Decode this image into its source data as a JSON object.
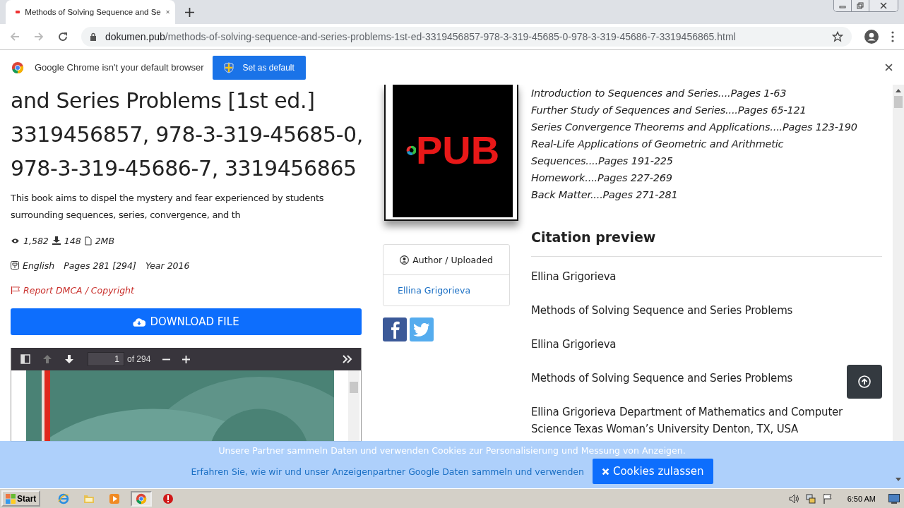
{
  "browser": {
    "tab_title": "Methods of Solving Sequence and Se",
    "url_domain": "dokumen.pub",
    "url_path": "/methods-of-solving-sequence-and-series-problems-1st-ed-3319456857-978-3-319-45685-0-978-3-319-45686-7-3319456865.html"
  },
  "infobar": {
    "message": "Google Chrome isn't your default browser",
    "button": "Set as default"
  },
  "book": {
    "title": "and Series Problems [1st ed.] 3319456857, 978-3-319-45685-0, 978-3-319-45686-7, 3319456865",
    "description": "This book aims to dispel the mystery and fear experienced by students surrounding sequences, series, convergence, and th",
    "views": "1,582",
    "downloads": "148",
    "size": "2MB",
    "language": "English",
    "pages": "Pages 281 [294]",
    "year": "Year 2016",
    "report": "Report DMCA / Copyright",
    "download": "DOWNLOAD FILE"
  },
  "pdf_viewer": {
    "page": "1",
    "total": "of 294",
    "prev_disabled": true
  },
  "cover": {
    "logo": "PUB"
  },
  "author_card": {
    "heading": "Author / Uploaded",
    "name": "Ellina Grigorieva"
  },
  "toc": [
    "Introduction to Sequences and Series....Pages 1-63",
    "Further Study of Sequences and Series....Pages 65-121",
    "Series Convergence Theorems and Applications....Pages 123-190",
    "Real-Life Applications of Geometric and Arithmetic Sequences....Pages 191-225",
    "Homework....Pages 227-269",
    "Back Matter....Pages 271-281"
  ],
  "citation": {
    "heading": "Citation preview",
    "paragraphs": [
      "Ellina Grigorieva",
      "Methods of Solving Sequence and Series Problems",
      "Ellina Grigorieva",
      "Methods of Solving Sequence and Series Problems",
      "Ellina Grigorieva Department of Mathematics and Computer Science Texas Woman’s University Denton, TX, USA"
    ]
  },
  "cookie_banner": {
    "message": "Unsere Partner sammeln Daten und verwenden Cookies zur Personalisierung und Messung von Anzeigen.",
    "link": "Erfahren Sie, wie wir und unser Anzeigenpartner Google Daten sammeln und verwenden",
    "button": "Cookies zulassen"
  },
  "taskbar": {
    "start": "Start",
    "apps": [
      {
        "kind": "ie",
        "active": false
      },
      {
        "kind": "folder",
        "active": false
      },
      {
        "kind": "media",
        "active": false
      },
      {
        "kind": "chrome",
        "active": true
      },
      {
        "kind": "stop",
        "active": false
      }
    ],
    "clock": "6:50 AM"
  }
}
